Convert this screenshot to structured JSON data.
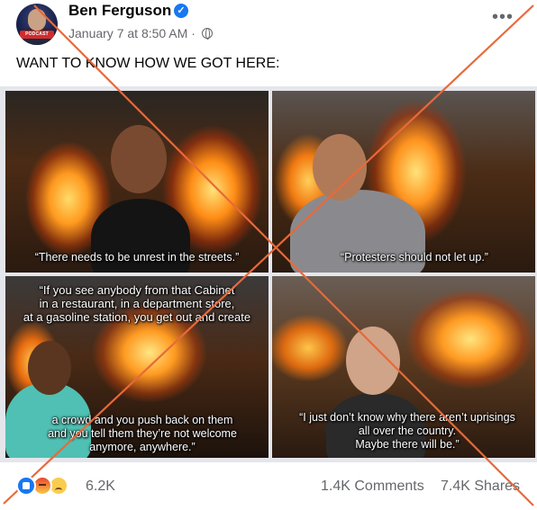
{
  "post": {
    "author": "Ben Ferguson",
    "verified_icon": "verified-check-icon",
    "timestamp": "January 7 at 8:50 AM",
    "separator": " · ",
    "audience_icon": "globe-icon",
    "more_icon": "ellipsis-icon",
    "more_label": "•••",
    "verified_label": "✓",
    "avatar_badge": "PODCAST",
    "text": "WANT TO KNOW HOW WE GOT HERE:"
  },
  "images": [
    {
      "caption": "“There needs to be unrest in the streets.”"
    },
    {
      "caption": "“Protesters should not let up.”"
    },
    {
      "caption_top": "“If you see anybody from that Cabinet\nin a restaurant, in a department store,\nat a gasoline station, you get out and create",
      "caption_bottom": "a crowd and you push back on them\nand you tell them they’re not welcome\nanymore, anywhere.”"
    },
    {
      "caption": "“I just don’t know why there aren’t uprisings\nall over the country.\nMaybe there will be.”"
    }
  ],
  "overlay": {
    "type": "red-x",
    "color": "#e8693a"
  },
  "footer": {
    "reactions": [
      "like",
      "angry",
      "sad"
    ],
    "reaction_count": "6.2K",
    "comments": "1.4K Comments",
    "shares": "7.4K Shares"
  },
  "colors": {
    "meta_gray": "#65676b",
    "facebook_blue": "#1877f2",
    "text": "#050505"
  }
}
